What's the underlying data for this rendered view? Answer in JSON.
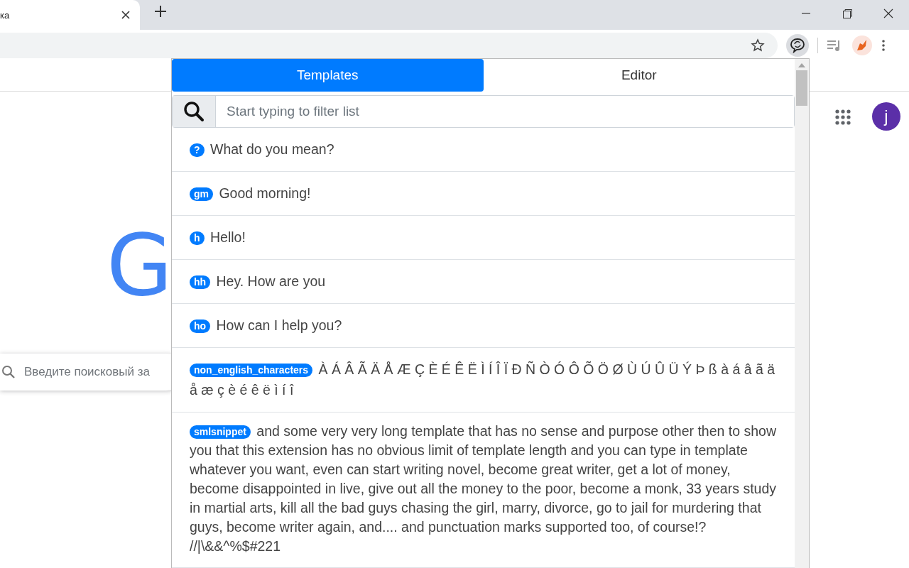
{
  "browser": {
    "tab_title": "ка",
    "page": {
      "logo_letter": "G",
      "search_placeholder": "Введите поисковый за",
      "avatar_letter": "j"
    }
  },
  "popup": {
    "tabs": [
      {
        "label": "Templates",
        "selected": true
      },
      {
        "label": "Editor",
        "selected": false
      }
    ],
    "search": {
      "placeholder": "Start typing to filter list"
    },
    "templates": [
      {
        "shortcut": "?",
        "text": "What do you mean?"
      },
      {
        "shortcut": "gm",
        "text": "Good morning!"
      },
      {
        "shortcut": "h",
        "text": "Hello!"
      },
      {
        "shortcut": "hh",
        "text": "Hey. How are you"
      },
      {
        "shortcut": "ho",
        "text": "How can I help you?"
      },
      {
        "shortcut": "non_english_characters",
        "text": "À Á Â Ã Ä Å Æ Ç È É Ê Ë Ì Í Î Ï Ð Ñ Ò Ó Ô Õ Ö Ø Ù Ú Û Ü Ý Þ ß à á â ã ä å æ ç è é ê ë ì í î"
      },
      {
        "shortcut": "smlsnippet",
        "text": "and some very very long template that has no sense and purpose other then to show you that this extension has no obvious limit of template length and you can type in template whatever you want, even can start writing novel, become great writer, get a lot of money, become disappointed in live, give out all the money to the poor, become a monk, 33 years study in martial arts, kill all the bad guys chasing the girl, marry, divorce, go to jail for murdering that guys, become writer again, and.... and punctuation marks supported too, of course!? //|\\&&^%$#221"
      }
    ]
  }
}
